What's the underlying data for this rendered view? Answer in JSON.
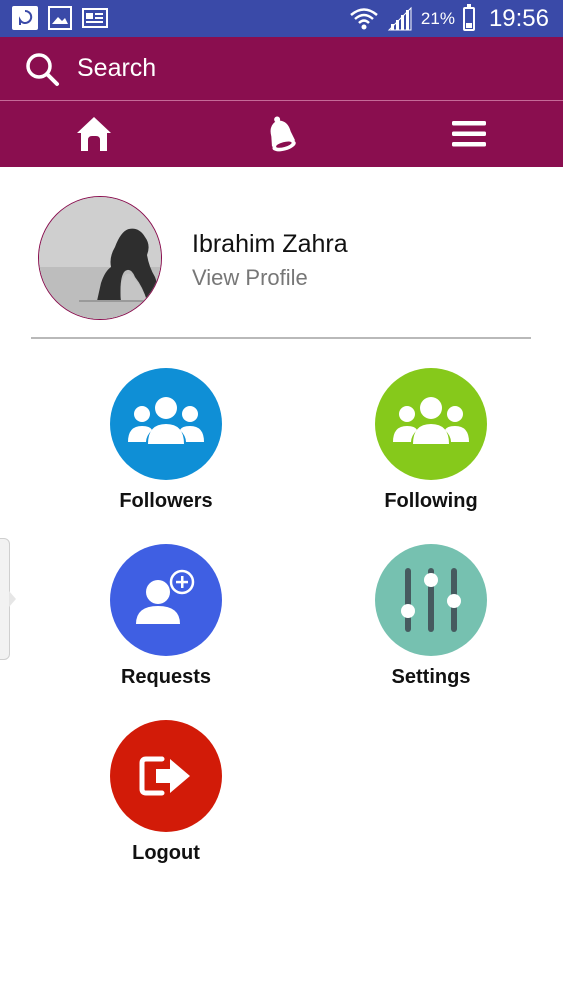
{
  "status_bar": {
    "battery_percent": "21%",
    "time": "19:56",
    "battery_level": 0.21,
    "icons": [
      "app-icon",
      "gallery-icon",
      "news-icon",
      "wifi-icon",
      "signal-icon",
      "battery-icon"
    ]
  },
  "search": {
    "label": "Search",
    "icon": "search-icon"
  },
  "nav": {
    "items": [
      {
        "icon": "home-icon"
      },
      {
        "icon": "bell-icon"
      },
      {
        "icon": "menu-icon"
      }
    ]
  },
  "profile": {
    "name": "Ibrahim Zahra",
    "link_label": "View Profile"
  },
  "menu": {
    "items": [
      {
        "label": "Followers",
        "icon": "followers-icon",
        "color": "#0f8fd6"
      },
      {
        "label": "Following",
        "icon": "following-icon",
        "color": "#86c91b"
      },
      {
        "label": "Requests",
        "icon": "add-user-icon",
        "color": "#3f5fe3"
      },
      {
        "label": "Settings",
        "icon": "sliders-icon",
        "color": "#76c1b0"
      },
      {
        "label": "Logout",
        "icon": "logout-icon",
        "color": "#d21b08"
      }
    ]
  },
  "colors": {
    "status_bar": "#3a4aa8",
    "app_bar": "#8a0e4f"
  }
}
